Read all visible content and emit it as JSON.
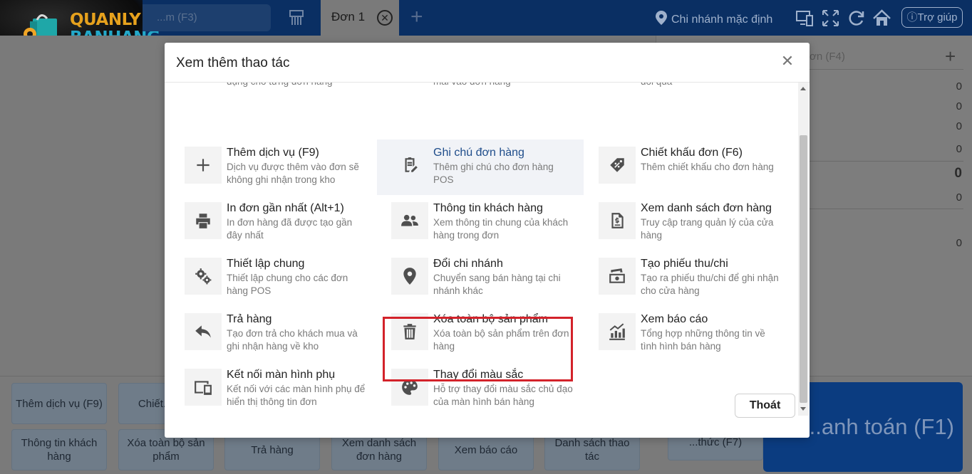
{
  "app": {
    "logo_line1": "QUANLY",
    "logo_line2": "BANHANG",
    "search_placeholder": "...m (F3)",
    "order_tab": "Đơn 1",
    "branch": "Chi nhánh mặc định",
    "help": "Trợ giúp"
  },
  "right_panel": {
    "label": "ơn (F4)",
    "values": [
      "0",
      "0",
      "0",
      "0",
      "0",
      "0",
      "0"
    ]
  },
  "bottom_buttons": [
    {
      "label": "Thêm dịch vụ (F9)"
    },
    {
      "label": "Chiết... đơn"
    },
    {
      "label": "Thông tin khách hàng"
    },
    {
      "label": "Xóa toàn bộ sản phẩm"
    },
    {
      "label": "Trả hàng"
    },
    {
      "label": "Xem danh sách đơn hàng"
    },
    {
      "label": "Xem báo cáo"
    },
    {
      "label": "Danh sách thao tác"
    },
    {
      "label": "...thức (F7)"
    }
  ],
  "pay_button": "...anh toán (F1)",
  "modal": {
    "title": "Xem thêm thao tác",
    "exit_label": "Thoát",
    "partial_row": [
      "dụng cho từng đơn hàng",
      "mãi vào đơn hàng",
      "đổi quà"
    ],
    "actions": [
      {
        "title": "Thêm dịch vụ (F9)",
        "desc": "Dịch vụ được thêm vào đơn sẽ không ghi nhận trong kho",
        "icon": "plus-icon"
      },
      {
        "title": "Ghi chú đơn hàng",
        "desc": "Thêm ghi chú cho đơn hàng POS",
        "icon": "note-icon",
        "highlighted": true
      },
      {
        "title": "Chiết khấu đơn (F6)",
        "desc": "Thêm chiết khấu cho đơn hàng",
        "icon": "discount-tag-icon"
      },
      {
        "title": "In đơn gần nhất (Alt+1)",
        "desc": "In đơn hàng đã được tạo gần đây nhất",
        "icon": "printer-icon"
      },
      {
        "title": "Thông tin khách hàng",
        "desc": "Xem thông tin chung của khách hàng trong đơn",
        "icon": "users-icon"
      },
      {
        "title": "Xem danh sách đơn hàng",
        "desc": "Truy cập trang quản lý của cửa hàng",
        "icon": "invoice-icon"
      },
      {
        "title": "Thiết lập chung",
        "desc": "Thiết lập chung cho các đơn hàng POS",
        "icon": "gears-icon"
      },
      {
        "title": "Đổi chi nhánh",
        "desc": "Chuyển sang bán hàng tại chi nhánh khác",
        "icon": "location-pin-icon"
      },
      {
        "title": "Tạo phiếu thu/chi",
        "desc": "Tạo ra phiếu thu/chi để ghi nhận cho cửa hàng",
        "icon": "money-icon"
      },
      {
        "title": "Trả hàng",
        "desc": "Tạo đơn trả cho khách mua và ghi nhận hàng về kho",
        "icon": "reply-icon"
      },
      {
        "title": "Xóa toàn bộ sản phẩm",
        "desc": "Xóa toàn bộ sản phẩm trên đơn hàng",
        "icon": "trash-icon"
      },
      {
        "title": "Xem báo cáo",
        "desc": "Tổng hợp những thông tin về tình hình bán hàng",
        "icon": "chart-icon"
      },
      {
        "title": "Kết nối màn hình phụ",
        "desc": "Kết nối với các màn hình phụ để hiển thị thông tin đơn",
        "icon": "devices-icon"
      },
      {
        "title": "Thay đổi màu sắc",
        "desc": "Hỗ trợ thay đổi màu sắc chủ đạo của màn hình bán hàng",
        "icon": "palette-icon"
      }
    ]
  },
  "colors": {
    "topbar": "#0a2f63",
    "accent_blue": "#1e4c8a",
    "highlight_box": "#d3222a",
    "logo_orange": "#e6a11d",
    "logo_teal": "#23a8c9"
  }
}
